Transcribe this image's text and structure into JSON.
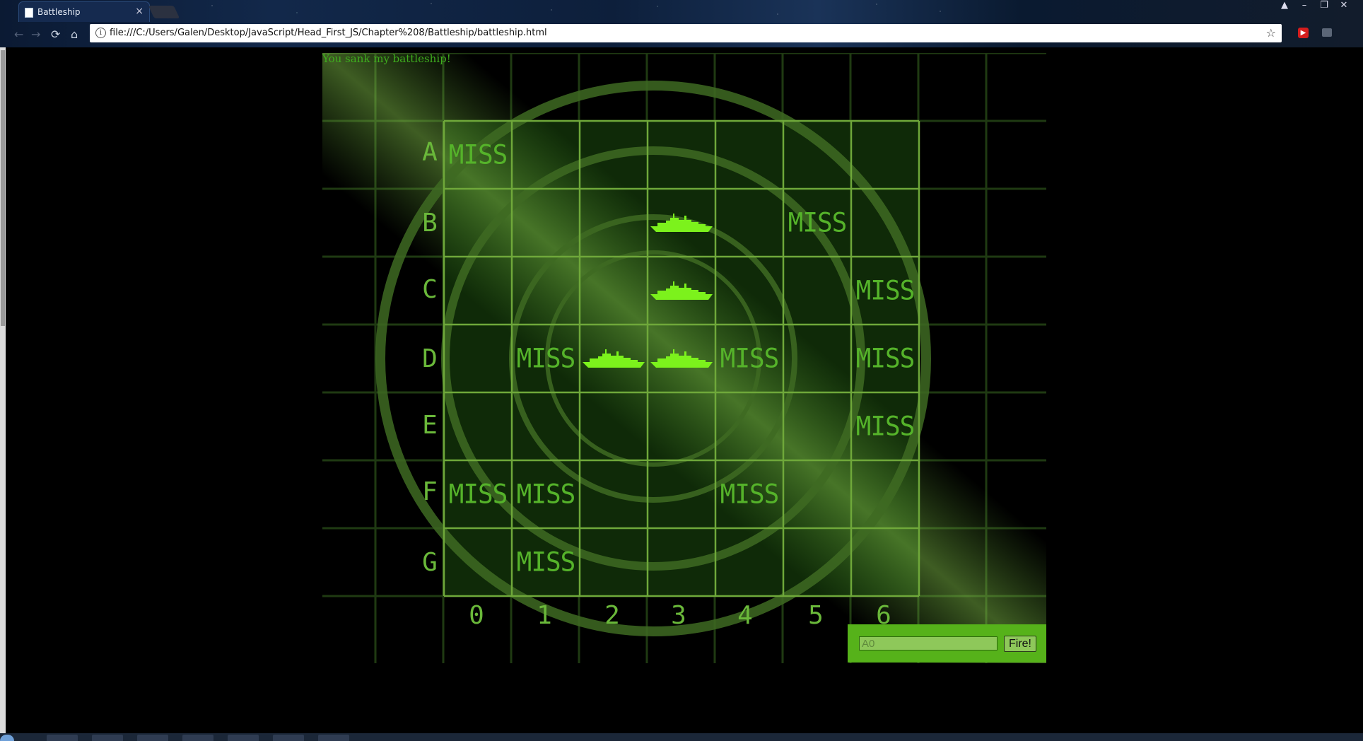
{
  "browser": {
    "tab_title": "Battleship",
    "tab_close": "×",
    "url": "file:///C:/Users/Galen/Desktop/JavaScript/Head_First_JS/Chapter%208/Battleship/battleship.html",
    "back_glyph": "←",
    "forward_glyph": "→",
    "reload_glyph": "⟳",
    "home_glyph": "⌂",
    "info_glyph": "i",
    "star_glyph": "☆",
    "window_controls": {
      "user": "▲",
      "minimize": "–",
      "restore": "❐",
      "close": "✕"
    }
  },
  "game": {
    "message": "You sank my battleship!",
    "row_labels": [
      "A",
      "B",
      "C",
      "D",
      "E",
      "F",
      "G"
    ],
    "col_labels": [
      "0",
      "1",
      "2",
      "3",
      "4",
      "5",
      "6"
    ],
    "miss_text": "MISS",
    "cells": [
      {
        "row": "A",
        "col": "0",
        "state": "miss"
      },
      {
        "row": "B",
        "col": "3",
        "state": "hit"
      },
      {
        "row": "B",
        "col": "5",
        "state": "miss"
      },
      {
        "row": "C",
        "col": "3",
        "state": "hit"
      },
      {
        "row": "C",
        "col": "6",
        "state": "miss"
      },
      {
        "row": "D",
        "col": "1",
        "state": "miss"
      },
      {
        "row": "D",
        "col": "2",
        "state": "hit"
      },
      {
        "row": "D",
        "col": "3",
        "state": "hit"
      },
      {
        "row": "D",
        "col": "4",
        "state": "miss"
      },
      {
        "row": "D",
        "col": "6",
        "state": "miss"
      },
      {
        "row": "E",
        "col": "6",
        "state": "miss"
      },
      {
        "row": "F",
        "col": "0",
        "state": "miss"
      },
      {
        "row": "F",
        "col": "1",
        "state": "miss"
      },
      {
        "row": "F",
        "col": "4",
        "state": "miss"
      },
      {
        "row": "G",
        "col": "1",
        "state": "miss"
      }
    ],
    "guess_placeholder": "A0",
    "fire_label": "Fire!",
    "colors": {
      "accent": "#56b21a",
      "grid": "#6fa83a",
      "ship": "#7cf21c",
      "miss": "#55b32a"
    }
  }
}
